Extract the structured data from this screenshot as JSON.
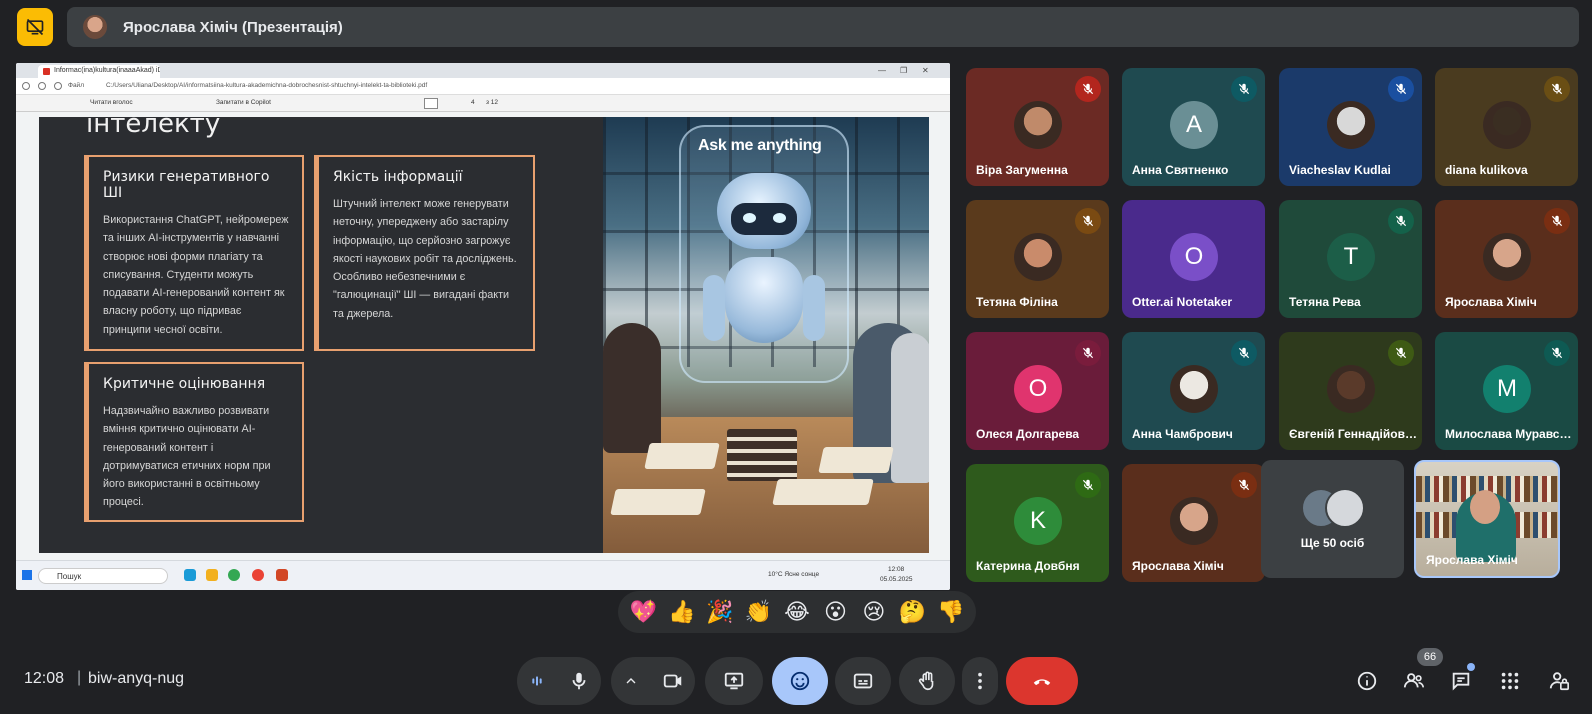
{
  "presenter": {
    "name": "Ярослава Хіміч (Презентація)"
  },
  "browser": {
    "tab_title": "Informac(ina)kultura(inaaaAkad) iDSE...",
    "address": "C:/Users/Uliana/Desktop/AI/informatsiina-kultura-akademichna-dobrochesnist-shtuchnyi-intelekt-ta-biblioteki.pdf",
    "address_prefix": "Файл",
    "pdf_toolbar": {
      "read_aloud": "Читати вголос",
      "ask_copilot": "Запитати в Copilot",
      "page_current": "4",
      "page_total": "з 12"
    }
  },
  "slide": {
    "title": "інтелекту",
    "cards": [
      {
        "title": "Ризики генеративного ШІ",
        "body": "Використання ChatGPT, нейромереж та інших AI-інструментів у навчанні створює нові форми плагіату та списування. Студенти можуть подавати AI-генерований контент як власну роботу, що підриває принципи чесної освіти."
      },
      {
        "title": "Якість інформації",
        "body": "Штучний інтелект може генерувати неточну, упереджену або застарілу інформацію, що серйозно загрожує якості наукових робіт та досліджень. Особливо небезпечними є \"галюцинації\" ШІ — вигадані факти та джерела."
      },
      {
        "title": "Критичне оцінювання",
        "body": "Надзвичайно важливо розвивати вміння критично оцінювати AI-генерований контент і дотримуватися етичних норм при його використанні в освітньому процесі."
      }
    ],
    "image_caption": "Ask me anything"
  },
  "taskbar": {
    "search_placeholder": "Пошук",
    "weather": "10°C Ясне сонце",
    "time": "12:08",
    "date": "05.05.2025"
  },
  "participants": [
    {
      "name": "Віра Загуменна",
      "type": "photo",
      "bg": "#6b2a24",
      "avatar": "#c08a6a",
      "mic": "#b3261e"
    },
    {
      "name": "Анна Святненко",
      "type": "letter",
      "letter": "А",
      "bg": "#1f4a50",
      "avatar": "#6a8f95",
      "mic": "#0e5a63"
    },
    {
      "name": "Viacheslav Kudlai",
      "type": "photo",
      "bg": "#1b3a6a",
      "avatar": "#d8d8d8",
      "mic": "#1a4fa0"
    },
    {
      "name": "diana kulikova",
      "type": "photo",
      "bg": "#4a3b1f",
      "avatar": "#3a2e22",
      "mic": "#6a4e14"
    },
    {
      "name": "Тетяна Філіна",
      "type": "photo",
      "bg": "#5a3a1c",
      "avatar": "#c98b6b",
      "mic": "#7a4a12"
    },
    {
      "name": "Otter.ai Notetaker",
      "type": "letter",
      "letter": "O",
      "bg": "#4a2a8c",
      "avatar": "#7a4fc8",
      "mic": ""
    },
    {
      "name": "Тетяна Рева",
      "type": "letter",
      "letter": "T",
      "bg": "#1f4a3a",
      "avatar": "#1c5e48",
      "mic": "#14624a"
    },
    {
      "name": "Ярослава Хіміч",
      "type": "photo",
      "bg": "#5a2e1c",
      "avatar": "#d7a58a",
      "mic": "#7a2e12"
    },
    {
      "name": "Олеся Долгарева",
      "type": "letter",
      "letter": "O",
      "bg": "#6a1c3a",
      "avatar": "#e0346e",
      "mic": "#7a1c3c"
    },
    {
      "name": "Анна Чамбрович",
      "type": "photo",
      "bg": "#1f4a50",
      "avatar": "#ece8e2",
      "mic": "#0e5a63"
    },
    {
      "name": "Євгеній Геннадійович",
      "type": "photo",
      "bg": "#2e3a1c",
      "avatar": "#5a3a2a",
      "mic": "#3e5a14"
    },
    {
      "name": "Милослава Муравська",
      "type": "letter",
      "letter": "M",
      "bg": "#1a4a44",
      "avatar": "#12806e",
      "mic": "#0e5a53"
    },
    {
      "name": "Катерина Довбня",
      "type": "letter",
      "letter": "K",
      "bg": "#2e5a1c",
      "avatar": "#2e8c3a",
      "mic": "#2e6a14"
    },
    {
      "name": "Ярослава Хіміч",
      "type": "photo",
      "bg": "#5a2e1c",
      "avatar": "#d7a58a",
      "mic": "#7a2e12"
    }
  ],
  "more_participants": {
    "label": "Ще 50 осіб"
  },
  "self_view": {
    "name": "Ярослава Хіміч"
  },
  "reactions": [
    "💖",
    "👍",
    "🎉",
    "👏",
    "😂",
    "😮",
    "😢",
    "🤔",
    "👎"
  ],
  "footer": {
    "time": "12:08",
    "separator": "|",
    "meeting_code": "biw-anyq-nug"
  },
  "people_count": "66",
  "colors": {
    "end_call": "#dc362e",
    "active_control": "#a8c7fa",
    "accent_card_border": "#e8a06f",
    "presenting_icon": "#fbbc04"
  }
}
